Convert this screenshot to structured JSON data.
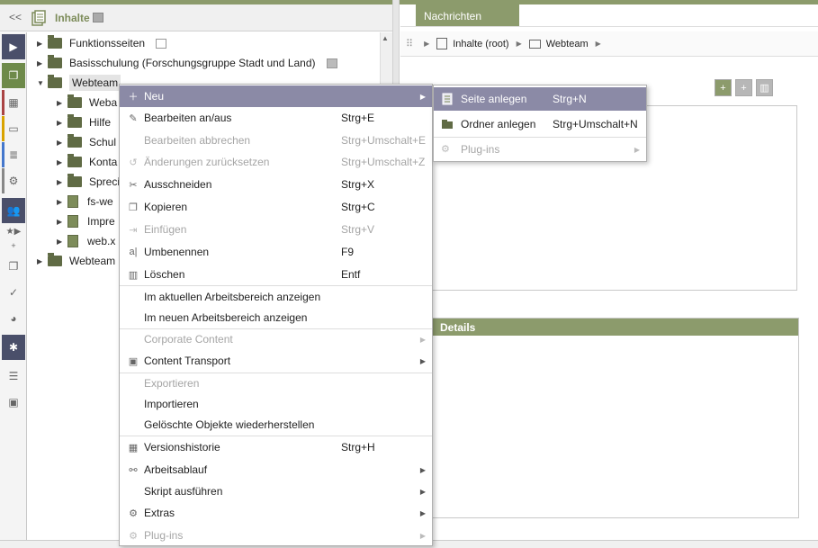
{
  "left_header": {
    "collapse": "<<",
    "title": "Inhalte"
  },
  "tree": [
    {
      "label": "Funktionsseiten",
      "type": "folder",
      "expanded": false
    },
    {
      "label": "Basisschulung (Forschungsgruppe Stadt und Land)",
      "type": "folder",
      "expanded": false
    },
    {
      "label": "Webteam",
      "type": "folder",
      "expanded": true
    },
    {
      "label": "Weba",
      "type": "folder",
      "expanded": false
    },
    {
      "label": "Hilfe",
      "type": "folder",
      "expanded": false
    },
    {
      "label": "Schul",
      "type": "folder",
      "expanded": false
    },
    {
      "label": "Konta",
      "type": "folder",
      "expanded": false
    },
    {
      "label": "Spreci",
      "type": "folder",
      "expanded": false
    },
    {
      "label": "fs-we",
      "type": "page",
      "expanded": false
    },
    {
      "label": "Impre",
      "type": "page",
      "expanded": false
    },
    {
      "label": "web.x",
      "type": "page",
      "expanded": false
    },
    {
      "label": "Webteam",
      "type": "folder",
      "expanded": false
    }
  ],
  "right": {
    "tab": "Nachrichten",
    "breadcrumb": [
      "Inhalte (root)",
      "Webteam"
    ],
    "details": "Details"
  },
  "menu": [
    {
      "label": "Neu",
      "key": "",
      "sub": true,
      "disabled": false,
      "icon": "new-icon",
      "highlight": true
    },
    {
      "label": "Bearbeiten an/aus",
      "key": "Strg+E",
      "icon": "edit-icon"
    },
    {
      "label": "Bearbeiten abbrechen",
      "key": "Strg+Umschalt+E",
      "disabled": true
    },
    {
      "label": "Änderungen zurücksetzen",
      "key": "Strg+Umschalt+Z",
      "disabled": true,
      "icon": "undo-icon"
    },
    {
      "label": "Ausschneiden",
      "key": "Strg+X",
      "icon": "scissors-icon"
    },
    {
      "label": "Kopieren",
      "key": "Strg+C",
      "icon": "copy-icon"
    },
    {
      "label": "Einfügen",
      "key": "Strg+V",
      "disabled": true,
      "icon": "paste-icon"
    },
    {
      "label": "Umbenennen",
      "key": "F9",
      "icon": "rename-icon"
    },
    {
      "label": "Löschen",
      "key": "Entf",
      "icon": "trash-icon"
    },
    {
      "label": "Im aktuellen Arbeitsbereich anzeigen"
    },
    {
      "label": "Im neuen Arbeitsbereich anzeigen"
    },
    {
      "label": "Corporate Content",
      "sub": true,
      "disabled": true
    },
    {
      "label": "Content Transport",
      "sub": true,
      "icon": "transport-icon"
    },
    {
      "label": "Exportieren",
      "disabled": true
    },
    {
      "label": "Importieren"
    },
    {
      "label": "Gelöschte Objekte wiederherstellen"
    },
    {
      "label": "Versionshistorie",
      "key": "Strg+H",
      "icon": "history-icon"
    },
    {
      "label": "Arbeitsablauf",
      "sub": true,
      "icon": "workflow-icon"
    },
    {
      "label": "Skript ausführen",
      "sub": true
    },
    {
      "label": "Extras",
      "sub": true,
      "icon": "gears-icon"
    },
    {
      "label": "Plug-ins",
      "sub": true,
      "disabled": true,
      "icon": "gears-icon"
    }
  ],
  "submenu": [
    {
      "label": "Seite anlegen",
      "key": "Strg+N",
      "highlight": true
    },
    {
      "label": "Ordner anlegen",
      "key": "Strg+Umschalt+N"
    },
    {
      "label": "Plug-ins",
      "key": "",
      "disabled": true,
      "sub": true
    }
  ]
}
